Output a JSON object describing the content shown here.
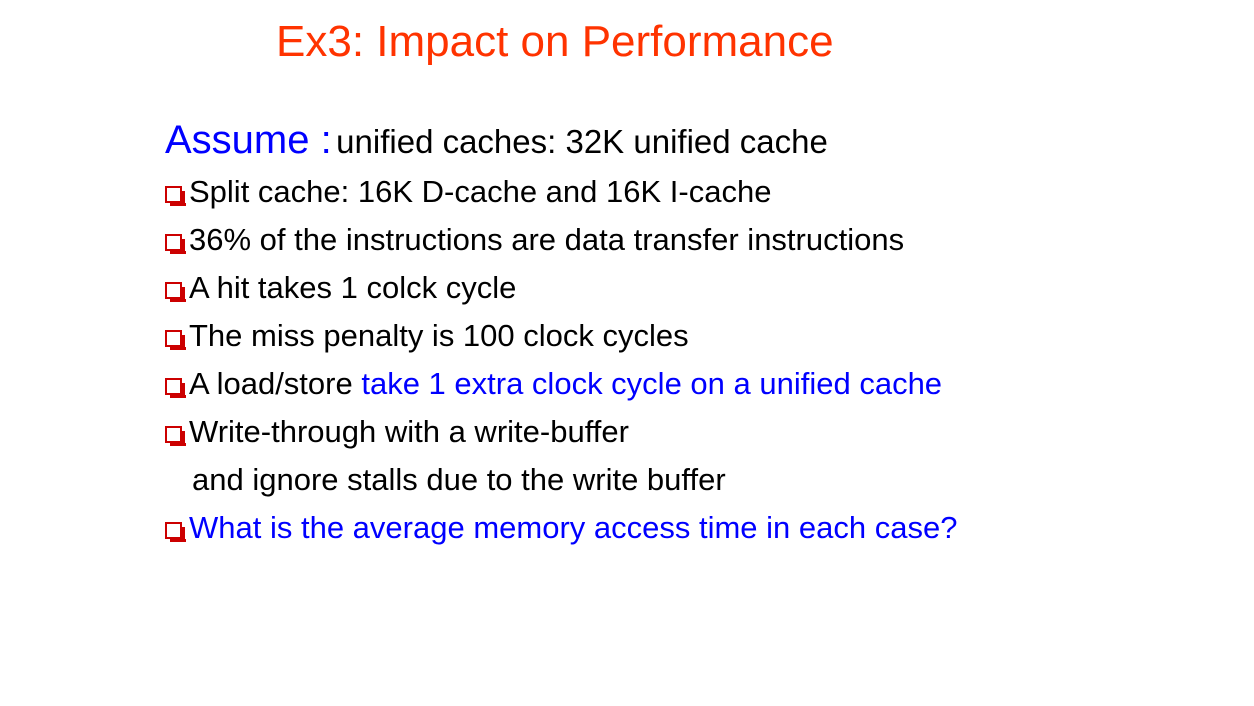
{
  "slide": {
    "title": "Ex3: Impact on Performance",
    "assume": {
      "label": "Assume :",
      "text": "unified caches: 32K unified cache"
    },
    "bullets": [
      {
        "text": "Split cache: 16K D-cache and 16K I-cache"
      },
      {
        "text": "36% of the instructions are data transfer instructions"
      },
      {
        "text": "A hit takes 1 colck cycle"
      },
      {
        "text": "The miss penalty is 100 clock cycles"
      },
      {
        "text": "A load/store ",
        "text_blue": "take 1 extra clock cycle on a unified cache"
      },
      {
        "text": "Write-through with a write-buffer",
        "continuation": "and ignore stalls due to the write buffer"
      },
      {
        "text_blue": "What is the average memory access time in each case?"
      }
    ],
    "colors": {
      "title": "#ff3300",
      "accent_blue": "#0000ff",
      "bullet": "#cc0000",
      "body_text": "#000000"
    },
    "bullet_icon": "red-hollow-square-with-shadow"
  }
}
